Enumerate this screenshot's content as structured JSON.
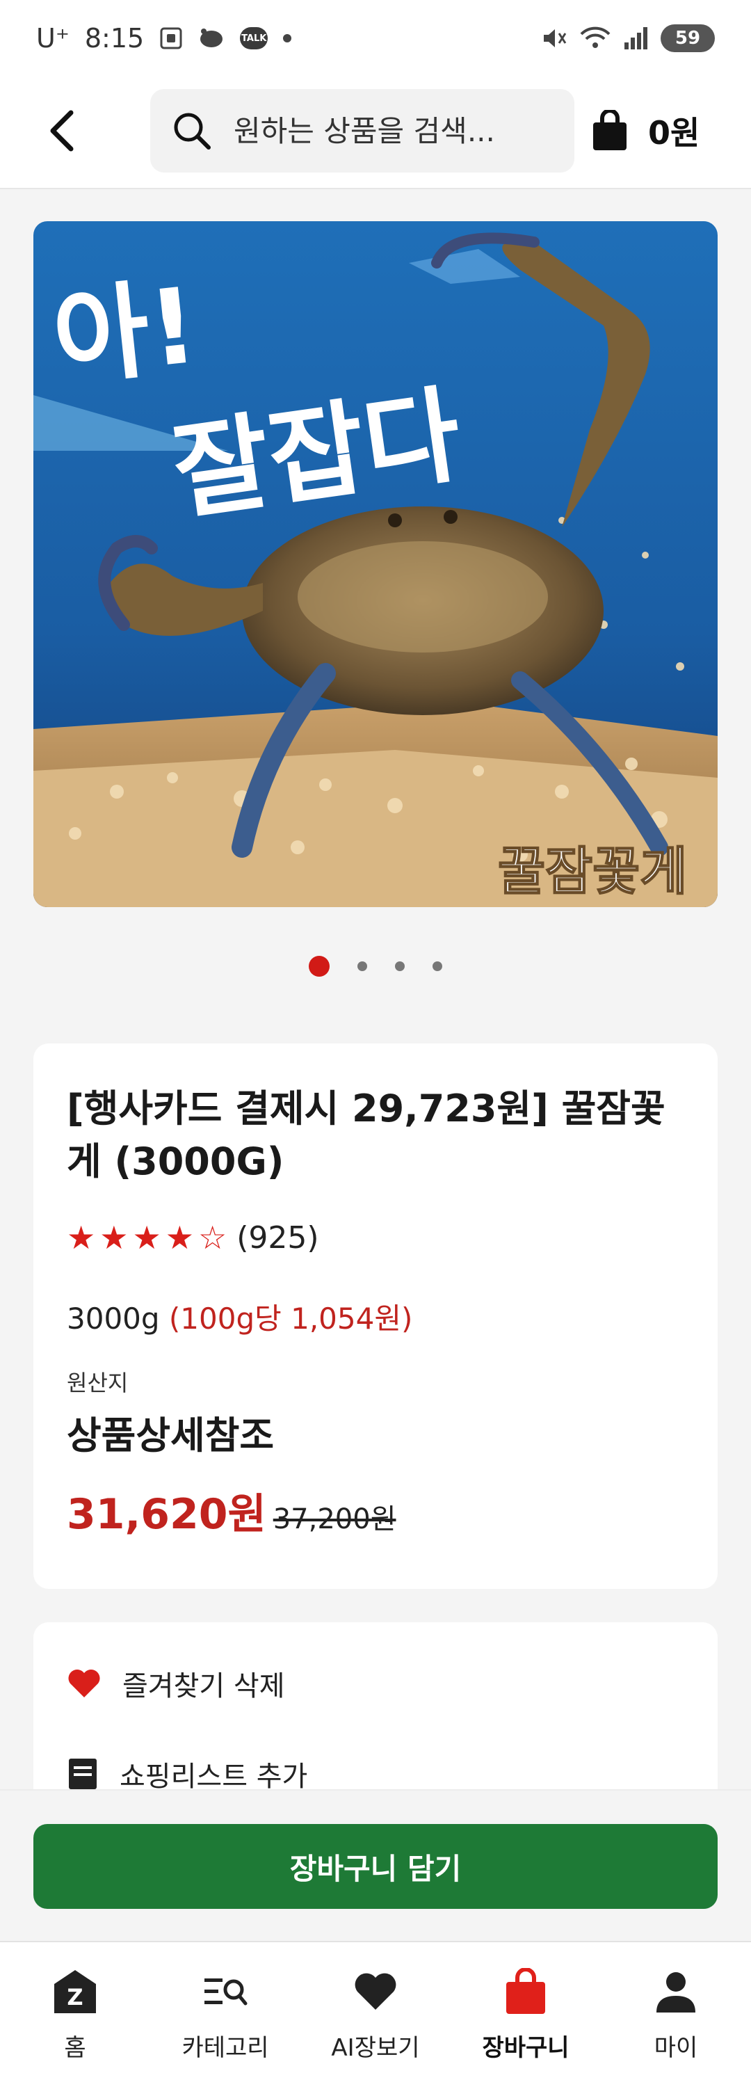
{
  "status_bar": {
    "carrier": "U⁺",
    "time": "8:15",
    "talk_badge": "TALK",
    "battery": "59"
  },
  "header": {
    "search_placeholder": "원하는 상품을 검색...",
    "cart_total": "0원"
  },
  "hero": {
    "headline_1": "아!",
    "headline_2": "잘잡다",
    "brand_overlay": "꿀잠꽃게"
  },
  "carousel": {
    "count": 4,
    "active_index": 0
  },
  "product": {
    "title": "[행사카드 결제시 29,723원] 꿀잠꽃게 (3000G)",
    "rating": 4,
    "rating_max": 5,
    "review_count": "(925)",
    "weight": "3000g",
    "unit_price": "(100g당 1,054원)",
    "origin_label": "원산지",
    "origin_value": "상품상세참조",
    "sale_price": "31,620원",
    "original_price": "37,200원"
  },
  "options": {
    "favorite_label": "즐겨찾기 삭제",
    "shopping_list_label": "쇼핑리스트 추가"
  },
  "cta": {
    "add_to_cart": "장바구니 담기"
  },
  "bottom_nav": {
    "items": [
      {
        "label": "홈",
        "icon": "home-icon"
      },
      {
        "label": "카테고리",
        "icon": "category-icon"
      },
      {
        "label": "AI장보기",
        "icon": "heart-icon"
      },
      {
        "label": "장바구니",
        "icon": "shopping-bag-icon"
      },
      {
        "label": "마이",
        "icon": "person-icon"
      }
    ],
    "active_index": 3
  },
  "colors": {
    "accent_red": "#d11a16",
    "price_red": "#c0231e",
    "cta_green": "#1e7a36"
  }
}
